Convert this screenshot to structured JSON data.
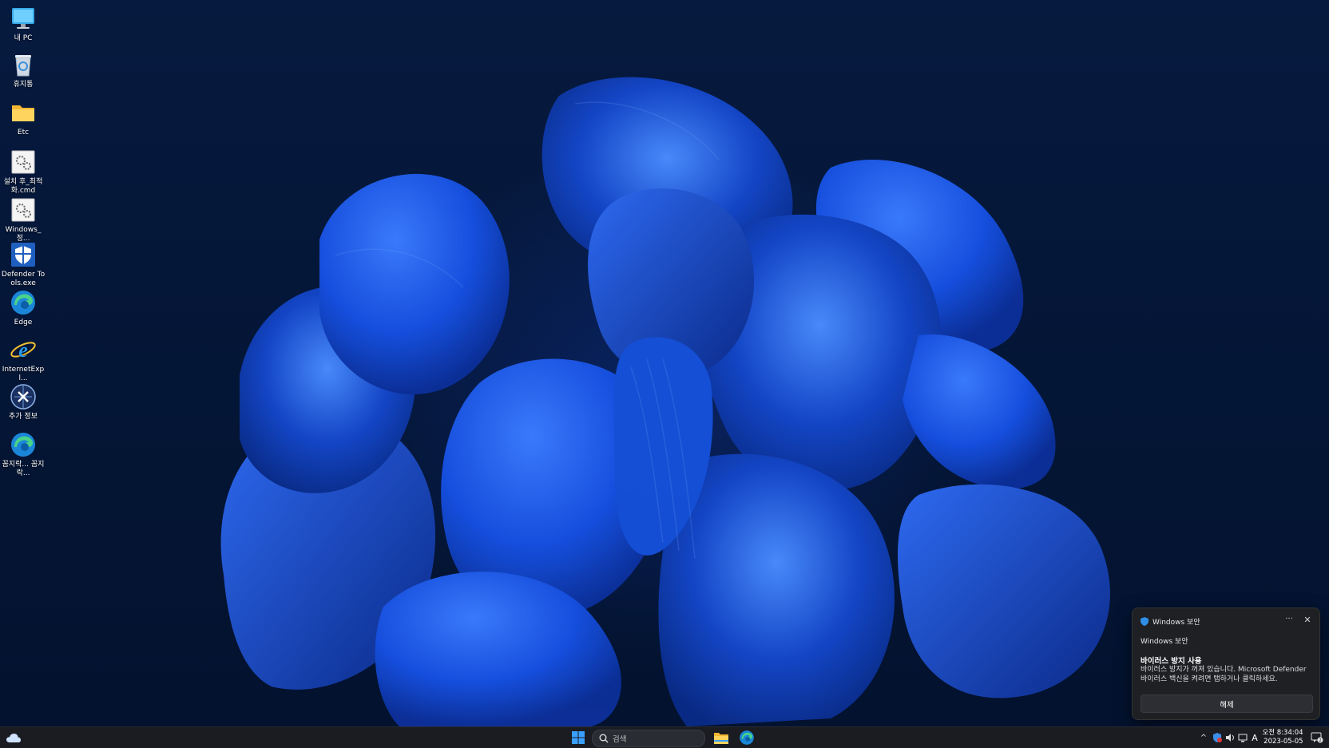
{
  "desktop_icons": [
    {
      "label": "내 PC",
      "icon": "computer-icon"
    },
    {
      "label": "휴지통",
      "icon": "recycle-bin-icon"
    },
    {
      "label": "Etc",
      "icon": "folder-icon"
    },
    {
      "label": "설치 후_최적화.cmd",
      "icon": "cmd-script-icon"
    },
    {
      "label": "Windows_정...",
      "icon": "cmd-script-icon"
    },
    {
      "label": "Defender Tools.exe",
      "icon": "defender-shield-icon"
    },
    {
      "label": "Edge",
      "icon": "edge-icon"
    },
    {
      "label": "InternetExpl...",
      "icon": "internet-explorer-icon"
    },
    {
      "label": "추가 정보",
      "icon": "info-globe-icon"
    },
    {
      "label": "꼼지락... 꼼지락...",
      "icon": "edge-icon"
    }
  ],
  "notification": {
    "header": "Windows 보안",
    "more_glyph": "···",
    "close_glyph": "✕",
    "app": "Windows 보안",
    "title": "바이러스 방지 사용",
    "body_line1": "바이러스 방지가 꺼져 있습니다. Microsoft Defender",
    "body_line2": "바이러스 백신을 켜려면 탭하거나 클릭하세요.",
    "action": "해제"
  },
  "taskbar": {
    "search_placeholder": "검색",
    "tray": {
      "up_arrow": "^",
      "ime": "A",
      "time": "오전 8:34:04",
      "date": "2023-05-05",
      "notification_count": "2"
    }
  },
  "colors": {
    "accent": "#0078d4",
    "wallpaper_bg": "#041433",
    "petal": "#1a5fe0",
    "toast_bg": "#1f2024",
    "taskbar_bg": "#1a1c22"
  }
}
